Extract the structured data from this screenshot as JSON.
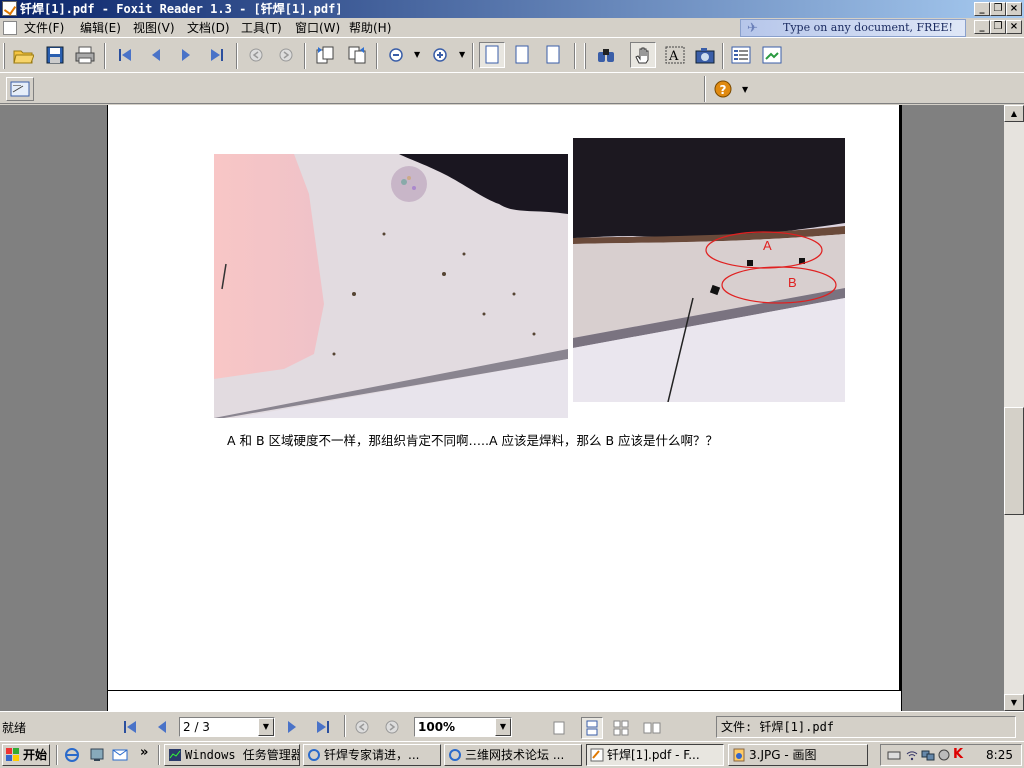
{
  "window": {
    "title": "钎焊[1].pdf - Foxit Reader 1.3 - [钎焊[1].pdf]"
  },
  "menubar": {
    "items": [
      "文件(F)",
      "编辑(E)",
      "视图(V)",
      "文档(D)",
      "工具(T)",
      "窗口(W)",
      "帮助(H)"
    ]
  },
  "ad_banner": {
    "text": "Type on any document, FREE!"
  },
  "document": {
    "caption": "A 和 B 区域硬度不一样，那组织肯定不同啊…..A 应该是焊料，那么 B 应该是什么啊？？",
    "image2_labels": [
      "A",
      "B"
    ],
    "label_color": "#e02020"
  },
  "statusbar": {
    "status": "就绪",
    "page_value": "2 / 3",
    "zoom_value": "100%",
    "file_label": "文件: 钎焊[1].pdf"
  },
  "taskbar": {
    "start_label": "开始",
    "chevron": "»",
    "tasks": [
      "Windows 任务管理器",
      "钎焊专家请进，...",
      "三维网技术论坛 ...",
      "钎焊[1].pdf - F...",
      "3.JPG - 画图"
    ],
    "clock": "8:25"
  }
}
